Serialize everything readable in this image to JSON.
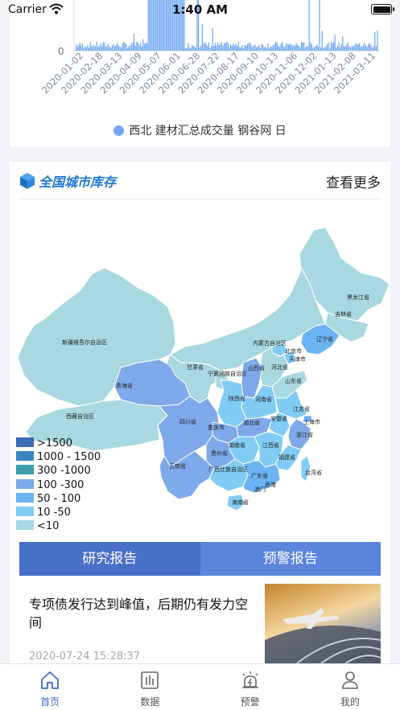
{
  "status": {
    "carrier": "Carrier",
    "time": "1:40 AM"
  },
  "trade_chart": {
    "y_tick": "0",
    "x_labels": [
      "2020-01-02",
      "2020-02-18",
      "2020-03-13",
      "2020-04-09",
      "2020-05-07",
      "2020-06-01",
      "2020-06-28",
      "2020-07-22",
      "2020-08-17",
      "2020-09-10",
      "2020-10-13",
      "2020-11-06",
      "2020-12-02",
      "2021-01-13",
      "2021-02-08",
      "2021-03-11"
    ],
    "legend": "西北 建材汇总成交量 钢谷网 日",
    "color": "#6fa6f5"
  },
  "inventory": {
    "title": "全国城市库存",
    "more": "查看更多",
    "legend": [
      {
        "label": ">1500",
        "color": "#3c6bb8"
      },
      {
        "label": "1000 - 1500",
        "color": "#3a86c2"
      },
      {
        "label": "300 -1000",
        "color": "#3b9dae"
      },
      {
        "label": "100 -300",
        "color": "#7ea9ea"
      },
      {
        "label": "50 - 100",
        "color": "#6cb3f2"
      },
      {
        "label": "10 -50",
        "color": "#80ccf4"
      },
      {
        "label": "<10",
        "color": "#a8d8e0"
      }
    ],
    "regions": [
      "黑龙江省",
      "吉林省",
      "辽宁省",
      "内蒙古自治区",
      "北京市",
      "天津市",
      "河北省",
      "新疆维吾尔自治区",
      "甘肃省",
      "宁夏回族自治区",
      "山西省",
      "山东省",
      "青海省",
      "陕西省",
      "河南省",
      "江苏省",
      "上海市",
      "西藏自治区",
      "四川省",
      "重庆市",
      "湖北省",
      "安徽省",
      "浙江省",
      "湖南省",
      "江西省",
      "贵州省",
      "福建省",
      "云南省",
      "广西壮族自治区",
      "广东省",
      "台湾省",
      "香港",
      "澳门",
      "海南省"
    ]
  },
  "report_tabs": [
    "研究报告",
    "预警报告"
  ],
  "news": {
    "title": "专项债发行达到峰值，后期仍有发力空间",
    "time": "2020-07-24 15:28:37"
  },
  "tabbar": [
    {
      "label": "首页",
      "icon": "home-icon",
      "active": true
    },
    {
      "label": "数据",
      "icon": "bar-chart-icon",
      "active": false
    },
    {
      "label": "预警",
      "icon": "alarm-icon",
      "active": false
    },
    {
      "label": "我的",
      "icon": "user-icon",
      "active": false
    }
  ]
}
